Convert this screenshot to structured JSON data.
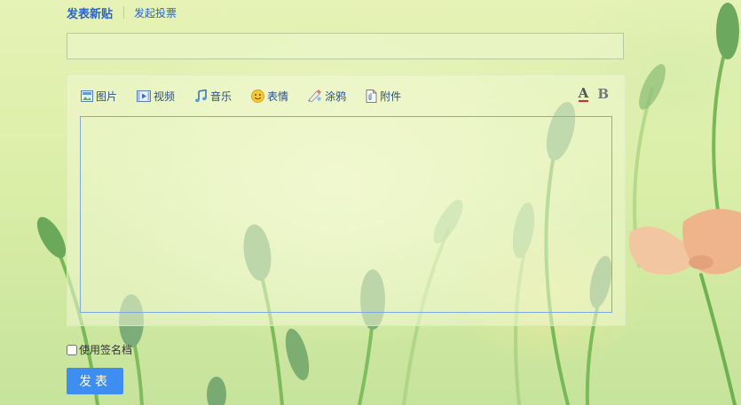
{
  "header": {
    "tab_active": "发表新贴",
    "tab_vote": "发起投票"
  },
  "title_field": {
    "value": "",
    "placeholder": ""
  },
  "toolbar": {
    "items": [
      {
        "label": "图片",
        "icon": "image-icon"
      },
      {
        "label": "视频",
        "icon": "video-icon"
      },
      {
        "label": "音乐",
        "icon": "music-icon"
      },
      {
        "label": "表情",
        "icon": "emoji-icon"
      },
      {
        "label": "涂鸦",
        "icon": "doodle-icon"
      },
      {
        "label": "附件",
        "icon": "attachment-icon"
      }
    ],
    "font_color_label": "A",
    "bold_label": "B"
  },
  "editor": {
    "content": ""
  },
  "signature": {
    "label": "使用签名档",
    "checked": false
  },
  "submit": {
    "label": "发表"
  },
  "colors": {
    "link": "#2b64c8",
    "button": "#3d8ef0",
    "editor_border": "#7fa8e0",
    "font_color_underline": "#d42b2b"
  }
}
